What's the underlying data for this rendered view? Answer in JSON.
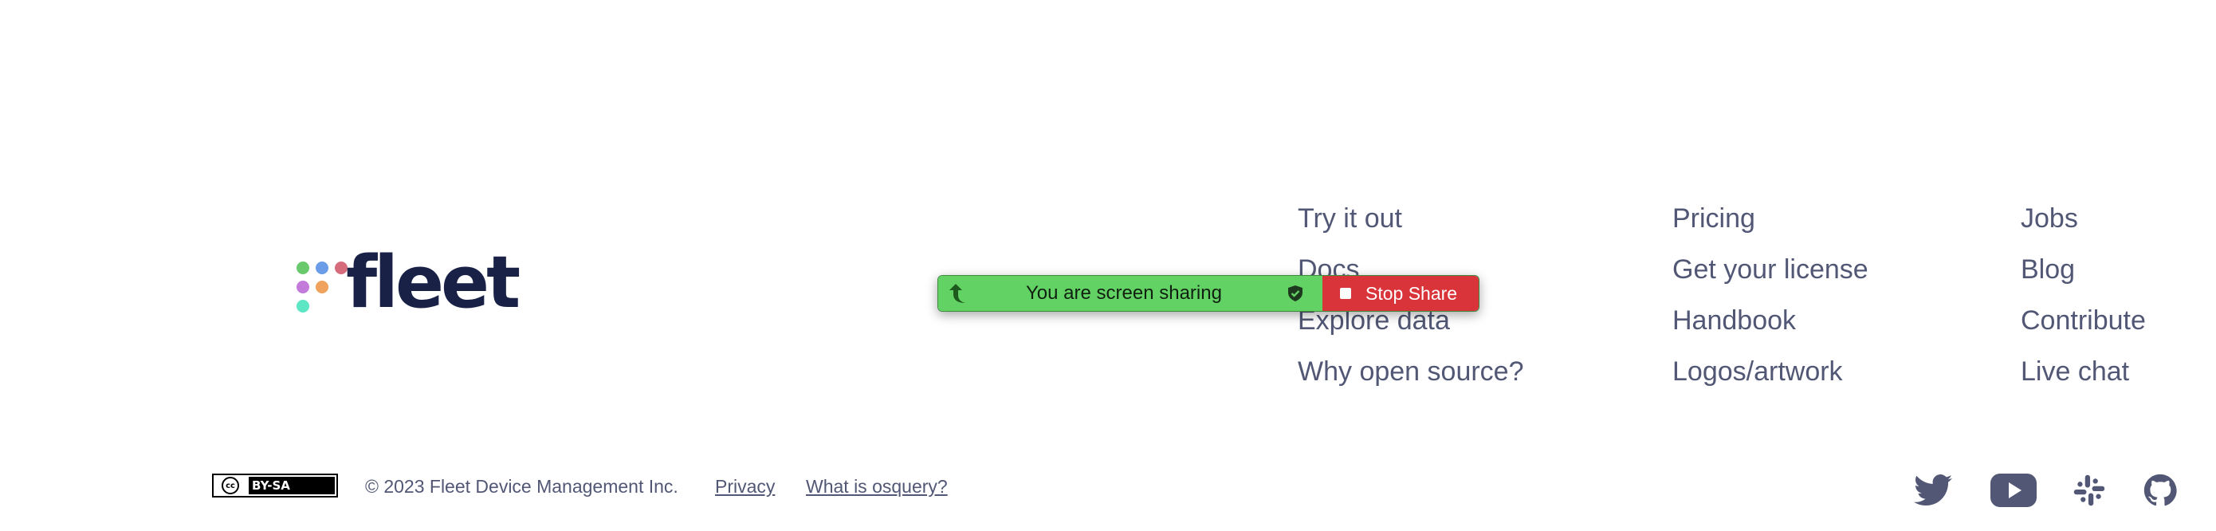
{
  "brand": {
    "wordmark": "fleet",
    "dot_colors": [
      "#6AC96D",
      "#6A9CE8",
      "#D66C7B",
      "#C27ADB",
      "#F0A35C",
      "#5CE6C3"
    ],
    "wordmark_color": "#192147"
  },
  "footer_nav": {
    "columns": [
      {
        "links": [
          "Try it out",
          "Docs",
          "Explore data",
          "Why open source?"
        ]
      },
      {
        "links": [
          "Pricing",
          "Get your license",
          "Handbook",
          "Logos/artwork"
        ]
      },
      {
        "links": [
          "Jobs",
          "Blog",
          "Contribute",
          "Live chat"
        ]
      }
    ]
  },
  "screen_share": {
    "message": "You are screen sharing",
    "stop_label": "Stop Share",
    "green": "#63D265",
    "red": "#D8343A"
  },
  "bottom_bar": {
    "license_cc": "cc",
    "license_by": "BY-SA",
    "copyright": "© 2023 Fleet Device Management Inc.",
    "privacy": "Privacy",
    "what_is_osquery": "What is osquery?"
  },
  "social_icons": [
    "twitter-icon",
    "youtube-icon",
    "slack-icon",
    "github-icon"
  ],
  "colors": {
    "text": "#515774",
    "icon": "#515774"
  }
}
